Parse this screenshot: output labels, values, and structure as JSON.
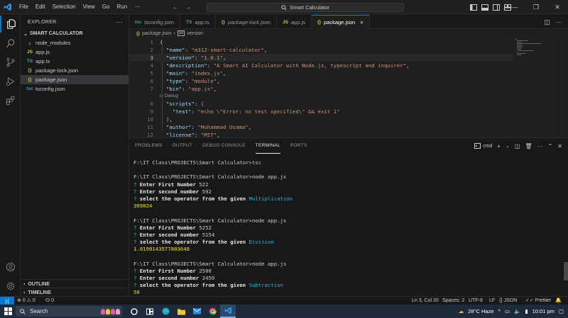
{
  "titlebar": {
    "menu": [
      "File",
      "Edit",
      "Selection",
      "View",
      "Go",
      "Run"
    ],
    "more": "···",
    "search": "Smart Calculator"
  },
  "sidebar": {
    "header": "EXPLORER",
    "folder": "SMART CALCULATOR",
    "items": [
      {
        "label": "node_modules",
        "icon": "›",
        "icon_color": "#cccccc",
        "selected": false
      },
      {
        "label": "app.js",
        "icon": "JS",
        "icon_color": "#cbcb41",
        "selected": false
      },
      {
        "label": "app.ts",
        "icon": "TS",
        "icon_color": "#519aba",
        "selected": false
      },
      {
        "label": "package-lock.json",
        "icon": "{}",
        "icon_color": "#cbcb41",
        "selected": false
      },
      {
        "label": "package.json",
        "icon": "{}",
        "icon_color": "#cbcb41",
        "selected": true
      },
      {
        "label": "tsconfig.json",
        "icon": "tsc",
        "icon_color": "#519aba",
        "selected": false
      }
    ],
    "outline": "OUTLINE",
    "timeline": "TIMELINE"
  },
  "tabs": [
    {
      "label": "tsconfig.json",
      "icon": "tsc",
      "icon_color": "#519aba",
      "italic": false,
      "active": false
    },
    {
      "label": "app.ts",
      "icon": "TS",
      "icon_color": "#519aba",
      "italic": false,
      "active": false
    },
    {
      "label": "package-lock.json",
      "icon": "{}",
      "icon_color": "#cbcb41",
      "italic": true,
      "active": false
    },
    {
      "label": "app.js",
      "icon": "JS",
      "icon_color": "#cbcb41",
      "italic": false,
      "active": false
    },
    {
      "label": "package.json",
      "icon": "{}",
      "icon_color": "#cbcb41",
      "italic": false,
      "active": true,
      "close": "×"
    }
  ],
  "breadcrumb": {
    "file": "package.json",
    "separator": "›",
    "symbol": "version"
  },
  "editor": {
    "codelens": "Debug",
    "lines": [
      {
        "n": "1",
        "text": "{"
      },
      {
        "n": "2",
        "text": "  \"name\": \"m312-smart-calculator\","
      },
      {
        "n": "3",
        "text": "  \"version\": \"1.0.1\","
      },
      {
        "n": "4",
        "text": "  \"description\": \"A Smart AI Calculator with Node.js, typescript and inquirer\","
      },
      {
        "n": "5",
        "text": "  \"main\": \"index.js\","
      },
      {
        "n": "6",
        "text": "  \"type\": \"module\","
      },
      {
        "n": "7",
        "text": "  \"bin\": \"app.js\","
      },
      {
        "n": "8",
        "text": "  \"scripts\": {"
      },
      {
        "n": "9",
        "text": "    \"test\": \"echo \\\"Error: no test specified\\\" && exit 1\""
      },
      {
        "n": "10",
        "text": "  },"
      },
      {
        "n": "11",
        "text": "  \"author\": \"Muhammad Usama\","
      },
      {
        "n": "12",
        "text": "  \"license\": \"MIT\","
      }
    ]
  },
  "panel": {
    "tabs": [
      "PROBLEMS",
      "OUTPUT",
      "DEBUG CONSOLE",
      "TERMINAL",
      "PORTS"
    ],
    "active_tab": "TERMINAL",
    "shell": "cmd"
  },
  "terminal": [
    {
      "type": "cmd",
      "text": "F:\\IT Class\\PROJECTS\\Smart Calculator>tsc"
    },
    {
      "type": "blank",
      "text": ""
    },
    {
      "type": "cmd",
      "text": "F:\\IT Class\\PROJECTS\\Smart Calculator>node app.js"
    },
    {
      "type": "q",
      "q": "Enter First Number",
      "a": "522"
    },
    {
      "type": "q",
      "q": "Enter second number",
      "a": "592"
    },
    {
      "type": "q",
      "q": "select the operator from the given",
      "a": "Multiplication",
      "sel": true
    },
    {
      "type": "res",
      "text": "309024"
    },
    {
      "type": "blank",
      "text": ""
    },
    {
      "type": "cmd",
      "text": "F:\\IT Class\\PROJECTS\\Smart Calculator>node app.js"
    },
    {
      "type": "q",
      "q": "Enter First Number",
      "a": "5252"
    },
    {
      "type": "q",
      "q": "Enter second number",
      "a": "5154"
    },
    {
      "type": "q",
      "q": "select the operator from the given",
      "a": "Division",
      "sel": true
    },
    {
      "type": "res",
      "text": "1.0190143577803648"
    },
    {
      "type": "blank",
      "text": ""
    },
    {
      "type": "cmd",
      "text": "F:\\IT Class\\PROJECTS\\Smart Calculator>node app.js"
    },
    {
      "type": "q",
      "q": "Enter First Number",
      "a": "2500"
    },
    {
      "type": "q",
      "q": "Enter second number",
      "a": "2450"
    },
    {
      "type": "q",
      "q": "select the operator from the given",
      "a": "Subtraction",
      "sel": true
    },
    {
      "type": "res",
      "text": "50"
    }
  ],
  "statusbar": {
    "errors": "0",
    "warnings": "0",
    "ports": "0",
    "position": "Ln 3, Col 20",
    "spaces": "Spaces: 2",
    "encoding": "UTF-8",
    "eol": "LF",
    "language": "JSON",
    "prettier": "Prettier"
  },
  "taskbar": {
    "search": "Search",
    "weather": "28°C  Haze",
    "time": "10:01 pm"
  },
  "colors": {
    "accent": "#0078d4",
    "key": "#9cdcfe",
    "string": "#ce9178",
    "prompt_green": "#23d18b",
    "result_yellow": "#e5e510",
    "selection_cyan": "#29b8db"
  }
}
